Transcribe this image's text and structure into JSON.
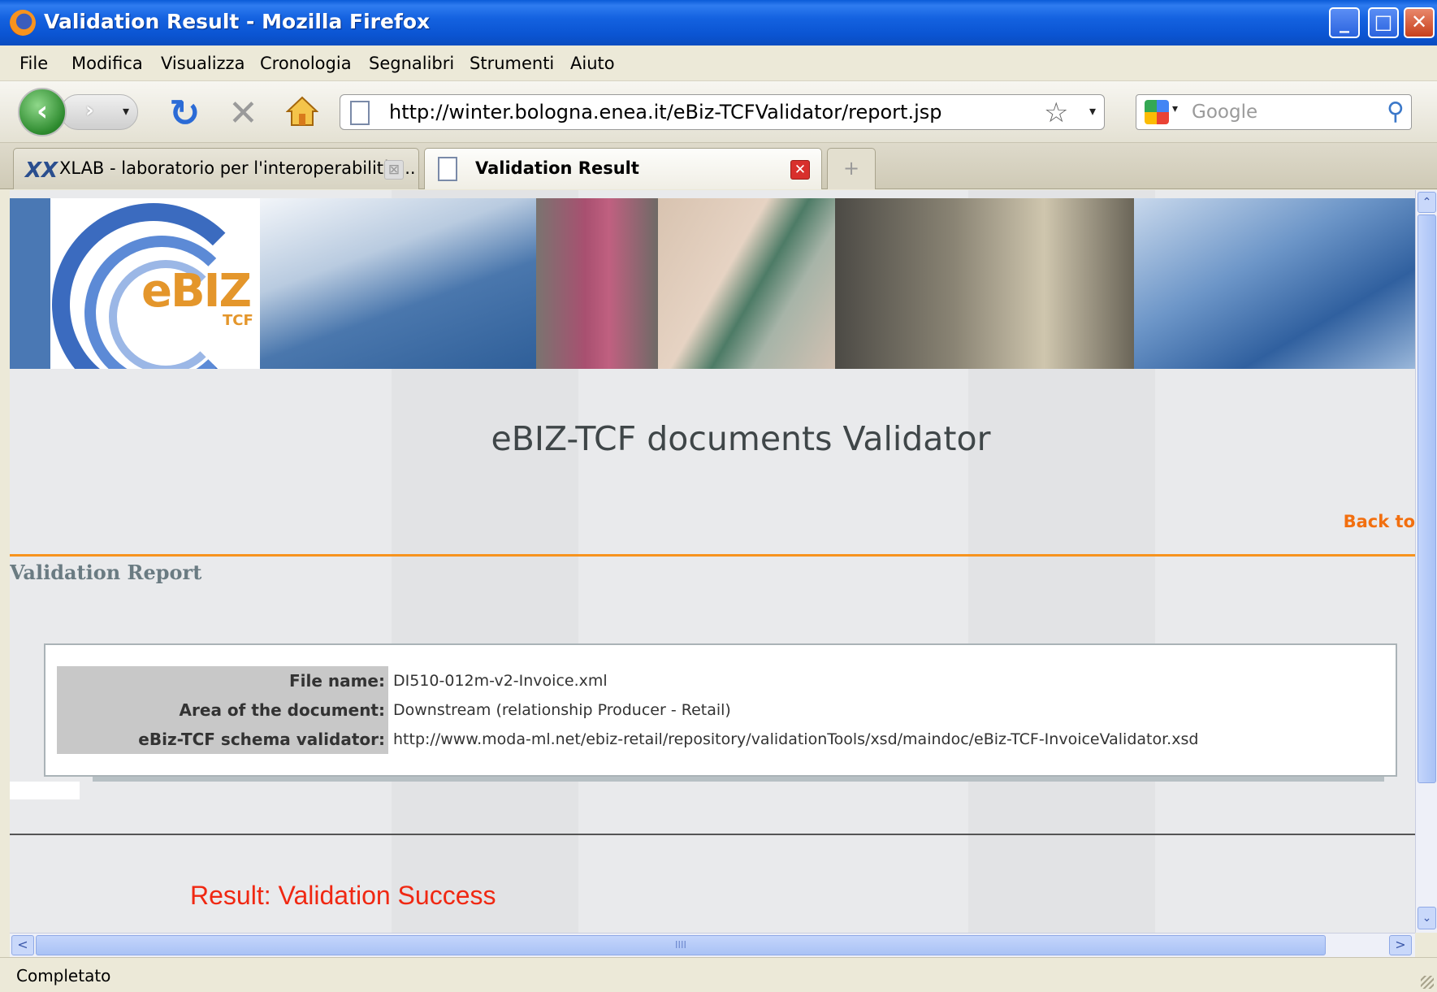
{
  "window": {
    "title": "Validation Result - Mozilla Firefox",
    "buttons": {
      "minimize": "_",
      "maximize": "□",
      "close": "✕"
    }
  },
  "menu": {
    "items": [
      "File",
      "Modifica",
      "Visualizza",
      "Cronologia",
      "Segnalibri",
      "Strumenti",
      "Aiuto"
    ]
  },
  "toolbar": {
    "back_glyph": "‹",
    "forward_glyph": "›",
    "dropdown_glyph": "▾",
    "reload_glyph": "↻",
    "stop_glyph": "✕",
    "url": "http://winter.bologna.enea.it/eBiz-TCFValidator/report.jsp",
    "bookmark_star": "☆",
    "search_placeholder": "Google",
    "search_glyph": "⚲"
  },
  "tabs": {
    "items": [
      {
        "label": "XLAB - laboratorio per l'interoperabilità ...",
        "icon": "xlab-logo-icon",
        "icon_text": "XX",
        "close_glyph": "⊠",
        "active": false
      },
      {
        "label": "Validation Result",
        "icon": "page-icon",
        "close_glyph": "✕",
        "active": true
      }
    ],
    "new_tab_glyph": "+",
    "list_glyph": "▾"
  },
  "page": {
    "banner": {
      "logo_text": "eBIZ",
      "logo_sub": "TCF"
    },
    "heading": "eBIZ-TCF documents Validator",
    "back_link": "Back to",
    "section_title": "Validation Report",
    "report": {
      "rows": [
        {
          "label": "File name:",
          "value": "DI510-012m-v2-Invoice.xml"
        },
        {
          "label": "Area of the document:",
          "value": "Downstream (relationship Producer - Retail)"
        },
        {
          "label": "eBiz-TCF schema validator:",
          "value": "http://www.moda-ml.net/ebiz-retail/repository/validationTools/xsd/maindoc/eBiz-TCF-InvoiceValidator.xsd"
        }
      ]
    },
    "result": "Result: Validation Success"
  },
  "scrollbars": {
    "up_glyph": "⌃",
    "down_glyph": "⌄",
    "left_glyph": "<",
    "right_glyph": ">",
    "grip_glyph": "IIII"
  },
  "status": {
    "text": "Completato"
  },
  "colors": {
    "accent_orange": "#f7931e",
    "result_red": "#f02812",
    "titlebar_blue": "#0b55d3"
  }
}
